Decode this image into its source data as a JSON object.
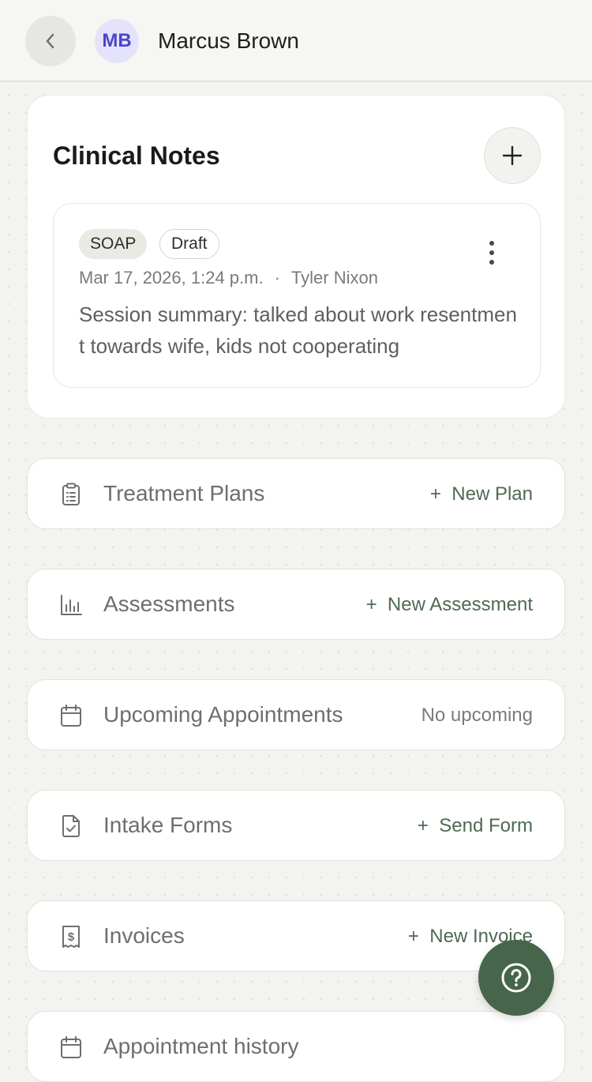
{
  "header": {
    "avatar_initials": "MB",
    "client_name": "Marcus Brown"
  },
  "clinical_notes": {
    "title": "Clinical Notes",
    "notes": [
      {
        "type_tag": "SOAP",
        "status_tag": "Draft",
        "datetime": "Mar 17, 2026, 1:24 p.m.",
        "separator": "·",
        "author": "Tyler Nixon",
        "summary": "Session summary: talked about work resentment towards wife, kids not cooperating"
      }
    ]
  },
  "sections": [
    {
      "label": "Treatment Plans",
      "action": "New Plan",
      "icon": "clipboard-icon"
    },
    {
      "label": "Assessments",
      "action": "New Assessment",
      "icon": "bar-chart-icon"
    },
    {
      "label": "Upcoming Appointments",
      "status": "No upcoming",
      "icon": "calendar-icon"
    },
    {
      "label": "Intake Forms",
      "action": "Send Form",
      "icon": "file-check-icon"
    },
    {
      "label": "Invoices",
      "action": "New Invoice",
      "icon": "receipt-icon"
    },
    {
      "label": "Appointment history",
      "icon": "calendar-icon"
    }
  ],
  "colors": {
    "accent": "#47654b",
    "action_text": "#4f6a53",
    "avatar_bg": "#e5e3fb",
    "avatar_text": "#4b44c7"
  }
}
